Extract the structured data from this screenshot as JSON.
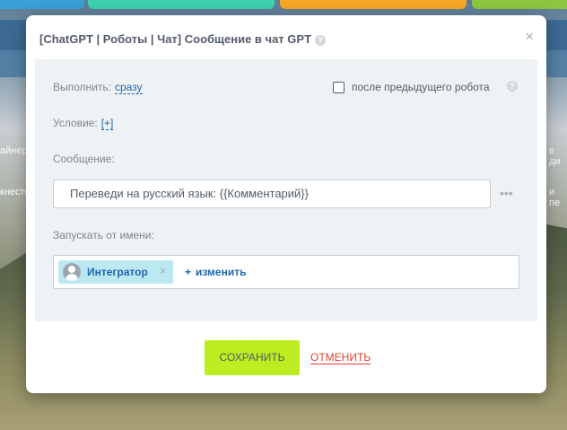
{
  "background": {
    "side_texts_left": [
      "айнеро",
      "кнести"
    ],
    "side_texts_right": [
      "в ди",
      "и пе"
    ]
  },
  "modal": {
    "title": "[ChatGPT | Роботы | Чат] Сообщение в чат GPT",
    "execute": {
      "label": "Выполнить:",
      "value": "сразу"
    },
    "after_previous": {
      "label": "после предыдущего робота",
      "checked": false
    },
    "condition": {
      "label": "Условие:",
      "value": "[+]"
    },
    "message": {
      "label": "Сообщение:",
      "value": "Переведи на русский язык: {{Комментарий}}"
    },
    "run_as": {
      "label": "Запускать от имени:",
      "user": "Интегратор",
      "change_label": "изменить"
    },
    "buttons": {
      "save": "СОХРАНИТЬ",
      "cancel": "ОТМЕНИТЬ"
    }
  },
  "colors": {
    "accent": "#2067b0",
    "save_bg": "#bbed21",
    "cancel": "#e0402e",
    "panel_bg": "#eef2f4"
  },
  "icons": [
    "help-icon",
    "close-icon",
    "more-dots-icon",
    "user-avatar-icon",
    "remove-tag-icon",
    "plus-icon"
  ]
}
